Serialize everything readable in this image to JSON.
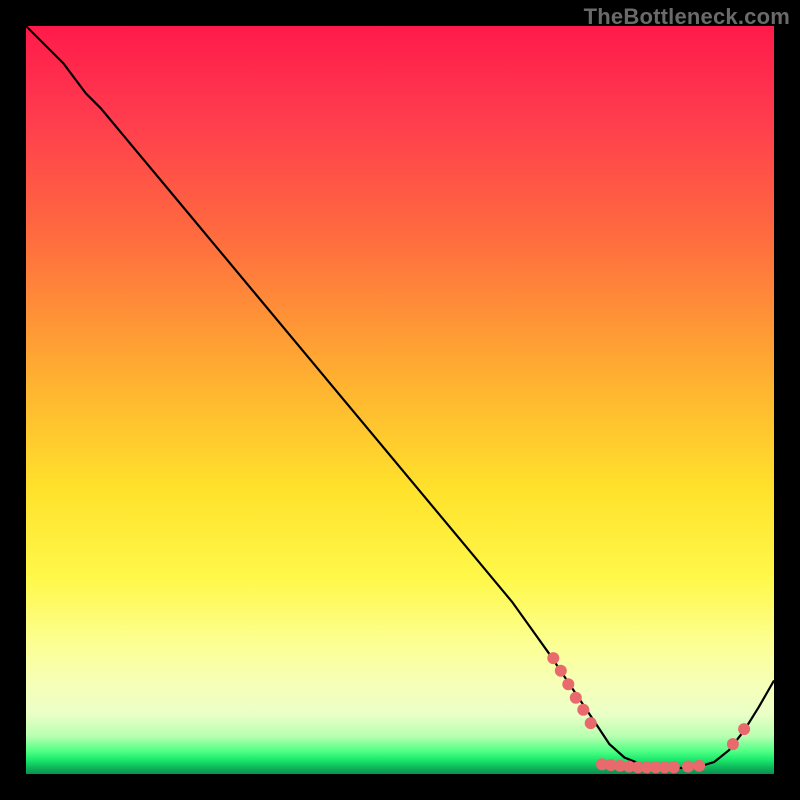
{
  "watermark": "TheBottleneck.com",
  "colors": {
    "page_bg": "#000000",
    "dot_fill": "#e96a6d",
    "curve_stroke": "#000000",
    "gradient_top": "#ff1a4b",
    "gradient_mid": "#ffe22c",
    "gradient_bottom": "#0a8f52"
  },
  "chart_data": {
    "type": "line",
    "title": "",
    "xlabel": "",
    "ylabel": "",
    "xlim": [
      0,
      100
    ],
    "ylim": [
      0,
      100
    ],
    "grid": false,
    "legend": false,
    "series": [
      {
        "name": "curve",
        "x": [
          0,
          5,
          8,
          10,
          15,
          20,
          25,
          30,
          35,
          40,
          45,
          50,
          55,
          60,
          65,
          70,
          72,
          74,
          76,
          78,
          80,
          82,
          84,
          86,
          88,
          90,
          92,
          94,
          96,
          98,
          100
        ],
        "y": [
          100,
          95,
          91,
          89,
          83,
          77,
          71,
          65,
          59,
          53,
          47,
          41,
          35,
          29,
          23,
          16,
          13,
          10,
          7,
          4,
          2.2,
          1.4,
          1.0,
          0.8,
          0.8,
          1.0,
          1.6,
          3.2,
          5.8,
          9.0,
          12.5
        ]
      }
    ],
    "markers": [
      {
        "x": 70.5,
        "y": 15.5
      },
      {
        "x": 71.5,
        "y": 13.8
      },
      {
        "x": 72.5,
        "y": 12.0
      },
      {
        "x": 73.5,
        "y": 10.2
      },
      {
        "x": 74.5,
        "y": 8.6
      },
      {
        "x": 75.5,
        "y": 6.8
      },
      {
        "x": 77.0,
        "y": 1.3
      },
      {
        "x": 78.2,
        "y": 1.2
      },
      {
        "x": 79.4,
        "y": 1.1
      },
      {
        "x": 80.6,
        "y": 1.0
      },
      {
        "x": 81.8,
        "y": 0.9
      },
      {
        "x": 83.0,
        "y": 0.9
      },
      {
        "x": 84.2,
        "y": 0.9
      },
      {
        "x": 85.4,
        "y": 0.9
      },
      {
        "x": 86.6,
        "y": 0.9
      },
      {
        "x": 88.5,
        "y": 1.0
      },
      {
        "x": 90.0,
        "y": 1.1
      },
      {
        "x": 94.5,
        "y": 4.0
      },
      {
        "x": 96.0,
        "y": 6.0
      }
    ]
  }
}
